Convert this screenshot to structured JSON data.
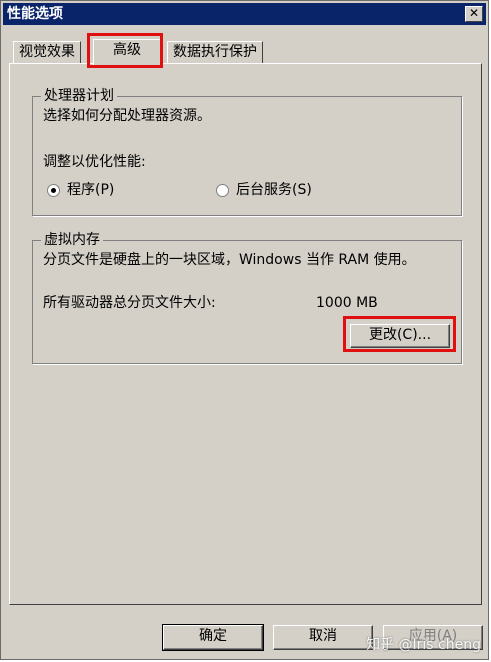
{
  "window": {
    "title": "性能选项",
    "close_glyph": "✕"
  },
  "tabs": [
    {
      "label": "视觉效果"
    },
    {
      "label": "高级"
    },
    {
      "label": "数据执行保护"
    }
  ],
  "processor": {
    "legend": "处理器计划",
    "description": "选择如何分配处理器资源。",
    "prompt": "调整以优化性能:",
    "option_programs": "程序(P)",
    "option_services": "后台服务(S)"
  },
  "memory": {
    "legend": "虚拟内存",
    "description": "分页文件是硬盘上的一块区域，Windows 当作 RAM 使用。",
    "total_label": "所有驱动器总分页文件大小:",
    "total_value": "1000 MB",
    "change_button": "更改(C)..."
  },
  "footer": {
    "ok": "确定",
    "cancel": "取消",
    "apply": "应用(A)"
  },
  "watermark": "知乎 @Iris cheng",
  "colors": {
    "title_bar": "#0a246a",
    "face": "#d4d0c8",
    "highlight": "#e01010"
  }
}
